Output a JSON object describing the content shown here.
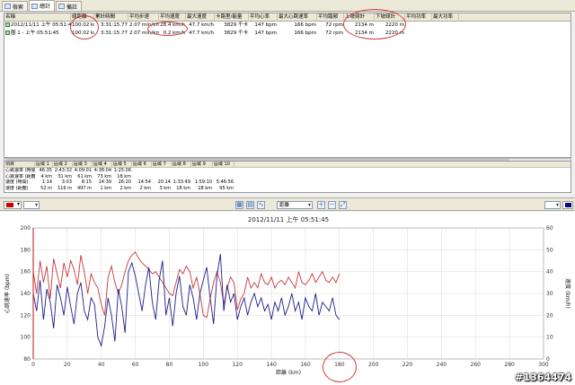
{
  "tabs": [
    {
      "label": "檢索"
    },
    {
      "label": "總計"
    },
    {
      "label": "備註"
    }
  ],
  "summary_table": {
    "columns": [
      "名稱",
      "總距離",
      "累計時間",
      "平均步速",
      "平均速度",
      "最大速度",
      "卡路里/能量",
      "平均心率",
      "最大心跳速率",
      "平均踏頻",
      "上坡總計",
      "下坡總計",
      "平均功率",
      "最大功率"
    ],
    "rows": [
      [
        "2012/11/11 上午 05:51:45",
        "100.02 km",
        "3:31:15.77",
        "2.07 min/km",
        "28.4 km/h",
        "47.7 km/h",
        "3829 千卡",
        "147 bpm",
        "166 bpm",
        "72 rpm",
        "2134 m",
        "2220 m",
        "",
        ""
      ],
      [
        "圈 1 - 上午 05:51:45",
        "100.02 km",
        "3:31:15.77",
        "2.07 min/km",
        "0.2 km/h",
        "47.7 km/h",
        "3829 千卡",
        "147 bpm",
        "166 bpm",
        "72 rpm",
        "2134 m",
        "2220 m",
        "",
        ""
      ]
    ]
  },
  "zone_table": {
    "columns": [
      "項目",
      "區域 1",
      "區域 2",
      "區域 3",
      "區域 4",
      "區域 5",
      "區域 6",
      "區域 7",
      "區域 8",
      "區域 9",
      "區域 10"
    ],
    "rows": [
      [
        "心跳速率 (時間)",
        "46:35",
        "2:43:32",
        "4:09:01",
        "4:38:04",
        "1:25:06",
        "",
        "",
        "",
        "",
        ""
      ],
      [
        "心跳速率 (距離)",
        "4 km",
        "31 km",
        "61 km",
        "73 km",
        "18 km",
        "",
        "",
        "",
        "",
        ""
      ],
      [
        "速度 (時間)",
        "1:14",
        "3:03",
        "8:15",
        "14:39",
        "26:20",
        "14:54",
        "20:14",
        "1:33:49",
        "1:59:10",
        "5:46:56"
      ],
      [
        "速度 (距離)",
        "52 m",
        "116 m",
        "497 m",
        "1 km",
        "2 km",
        "2 km",
        "3 km",
        "18 km",
        "28 km",
        "95 km"
      ]
    ]
  },
  "toolbar": {
    "selected_metric": "距離",
    "left_color": "#cc0000",
    "right_color": "#0a0a7a"
  },
  "chart_data": {
    "type": "line",
    "title": "2012/11/11 上午 05:51:45",
    "xlabel": "距離 (km)",
    "ylabel_left": "心跳速率 (bpm)",
    "ylabel_right": "速度 (km/h)",
    "xlim": [
      0,
      300
    ],
    "ylim_left": [
      80,
      200
    ],
    "ylim_right": [
      0,
      60
    ],
    "x_ticks": [
      0,
      20,
      40,
      60,
      80,
      100,
      120,
      140,
      160,
      180,
      200,
      220,
      240,
      260,
      280,
      300
    ],
    "y_left_ticks": [
      80,
      100,
      120,
      140,
      160,
      180,
      200
    ],
    "y_right_ticks": [
      0,
      10,
      20,
      30,
      40,
      50,
      60
    ],
    "grid": true,
    "series": [
      {
        "color": "#c8383c",
        "axis": "left",
        "x": [
          0,
          2,
          4,
          6,
          8,
          10,
          12,
          14,
          16,
          18,
          20,
          22,
          24,
          26,
          28,
          30,
          32,
          34,
          36,
          38,
          40,
          42,
          44,
          46,
          48,
          50,
          52,
          54,
          56,
          58,
          60,
          62,
          64,
          66,
          68,
          70,
          72,
          74,
          76,
          78,
          80,
          82,
          84,
          86,
          88,
          90,
          92,
          94,
          96,
          98,
          100,
          102,
          104,
          106,
          108,
          110,
          112,
          114,
          116,
          118,
          120,
          122,
          124,
          126,
          128,
          130,
          132,
          134,
          136,
          138,
          140,
          142,
          144,
          146,
          148,
          150,
          152,
          154,
          156,
          158,
          160,
          162,
          164,
          166,
          168,
          170,
          172,
          174,
          176,
          178,
          180
        ],
        "values": [
          160,
          140,
          170,
          150,
          165,
          135,
          172,
          158,
          145,
          168,
          155,
          170,
          162,
          148,
          175,
          160,
          140,
          158,
          150,
          145,
          130,
          120,
          155,
          165,
          150,
          140,
          148,
          160,
          170,
          175,
          178,
          172,
          168,
          165,
          162,
          158,
          160,
          155,
          150,
          145,
          140,
          138,
          150,
          162,
          158,
          165,
          160,
          145,
          155,
          140,
          120,
          118,
          135,
          150,
          160,
          150,
          130,
          145,
          155,
          150,
          125,
          135,
          140,
          155,
          145,
          150,
          145,
          158,
          150,
          148,
          155,
          145,
          150,
          152,
          148,
          155,
          150,
          145,
          160,
          150,
          148,
          152,
          158,
          150,
          155,
          160,
          152,
          150,
          155,
          150,
          158
        ]
      },
      {
        "color": "#1e1e8c",
        "axis": "right",
        "x": [
          0,
          2,
          4,
          6,
          8,
          10,
          12,
          14,
          16,
          18,
          20,
          22,
          24,
          26,
          28,
          30,
          32,
          34,
          36,
          38,
          40,
          42,
          44,
          46,
          48,
          50,
          52,
          54,
          56,
          58,
          60,
          62,
          64,
          66,
          68,
          70,
          72,
          74,
          76,
          78,
          80,
          82,
          84,
          86,
          88,
          90,
          92,
          94,
          96,
          98,
          100,
          102,
          104,
          106,
          108,
          110,
          112,
          114,
          116,
          118,
          120,
          122,
          124,
          126,
          128,
          130,
          132,
          134,
          136,
          138,
          140,
          142,
          144,
          146,
          148,
          150,
          152,
          154,
          156,
          158,
          160,
          162,
          164,
          166,
          168,
          170,
          172,
          174,
          176,
          178,
          180
        ],
        "values": [
          30,
          22,
          36,
          18,
          32,
          26,
          14,
          34,
          28,
          20,
          33,
          24,
          16,
          30,
          35,
          22,
          18,
          28,
          25,
          10,
          6,
          15,
          28,
          20,
          8,
          32,
          24,
          12,
          40,
          44,
          38,
          30,
          22,
          34,
          42,
          26,
          18,
          36,
          45,
          20,
          28,
          15,
          30,
          38,
          24,
          20,
          34,
          28,
          18,
          30,
          36,
          42,
          28,
          16,
          38,
          48,
          22,
          34,
          26,
          30,
          18,
          24,
          28,
          20,
          26,
          30,
          24,
          28,
          22,
          25,
          18,
          26,
          22,
          28,
          20,
          24,
          30,
          22,
          26,
          18,
          28,
          24,
          22,
          30,
          20,
          26,
          24,
          22,
          28,
          20,
          18
        ]
      }
    ]
  },
  "watermark": "#1364474"
}
